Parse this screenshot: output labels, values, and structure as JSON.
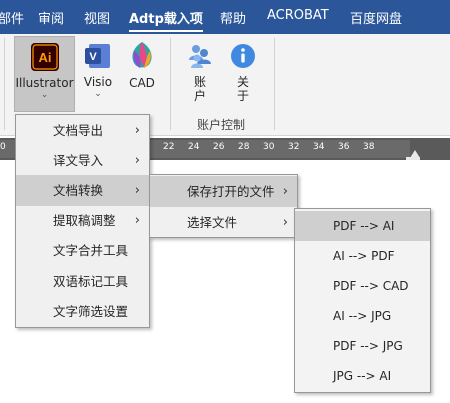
{
  "ribbon_tabs": [
    "部件",
    "审阅",
    "视图",
    "Adtp载入项",
    "帮助",
    "ACROBAT",
    "百度网盘"
  ],
  "ribbon": {
    "buttons": {
      "illustrator": {
        "label": "Illustrator",
        "icon": "illustrator-icon"
      },
      "visio": {
        "label": "Visio",
        "icon": "visio-icon"
      },
      "cad": {
        "label": "CAD",
        "icon": "cad-icon"
      },
      "account": {
        "label": "账\n户",
        "icon": "account-icon"
      },
      "about": {
        "label": "关\n于",
        "icon": "info-icon"
      }
    },
    "group_label": "账户控制"
  },
  "ruler": {
    "ticks": [
      "0",
      "22",
      "24",
      "26",
      "28",
      "30",
      "32",
      "34",
      "36",
      "38"
    ]
  },
  "menu1": {
    "items": [
      {
        "label": "文档导出",
        "has_submenu": true
      },
      {
        "label": "译文导入",
        "has_submenu": true
      },
      {
        "label": "文档转换",
        "has_submenu": true
      },
      {
        "label": "提取稿调整",
        "has_submenu": true
      },
      {
        "label": "文字合并工具",
        "has_submenu": false
      },
      {
        "label": "双语标记工具",
        "has_submenu": false
      },
      {
        "label": "文字筛选设置",
        "has_submenu": false
      }
    ]
  },
  "menu2": {
    "items": [
      {
        "label": "保存打开的文件",
        "has_submenu": true
      },
      {
        "label": "选择文件",
        "has_submenu": true
      }
    ]
  },
  "menu3": {
    "items": [
      "PDF --> AI",
      "AI --> PDF",
      "PDF --> CAD",
      "AI --> JPG",
      "PDF --> JPG",
      "JPG --> AI"
    ]
  },
  "colors": {
    "ribbon_tab_bar": "#2b579a",
    "menu_highlight": "#cfcfcf",
    "menu_bg": "#f0f0f0"
  }
}
